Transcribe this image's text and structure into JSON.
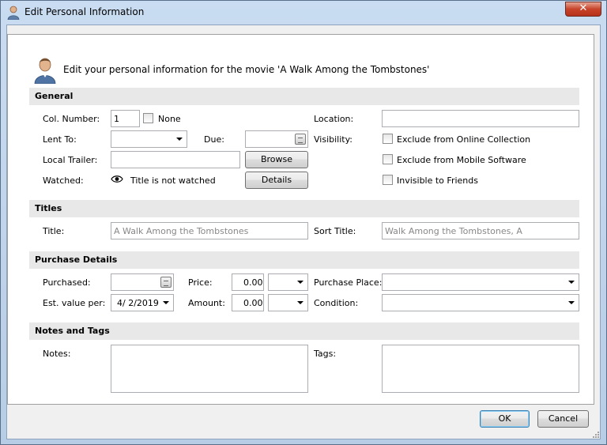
{
  "window": {
    "title": "Edit Personal Information",
    "close_symbol": "✕"
  },
  "header": {
    "text": "Edit your personal information for the movie 'A Walk Among the Tombstones'"
  },
  "sections": {
    "general": "General",
    "titles": "Titles",
    "purchase": "Purchase Details",
    "notes": "Notes and Tags"
  },
  "general": {
    "col_number_label": "Col. Number:",
    "col_number_value": "1",
    "none_label": "None",
    "lent_to_label": "Lent To:",
    "due_label": "Due:",
    "local_trailer_label": "Local Trailer:",
    "browse_label": "Browse",
    "watched_label": "Watched:",
    "watched_status": "Title is not watched",
    "details_label": "Details",
    "location_label": "Location:",
    "visibility_label": "Visibility:",
    "exclude_online": "Exclude from Online Collection",
    "exclude_mobile": "Exclude from Mobile Software",
    "invisible_friends": "Invisible to Friends"
  },
  "titles": {
    "title_label": "Title:",
    "title_value": "A Walk Among the Tombstones",
    "sort_title_label": "Sort Title:",
    "sort_title_value": "Walk Among the Tombstones, A"
  },
  "purchase": {
    "purchased_label": "Purchased:",
    "price_label": "Price:",
    "price_value": "0.00",
    "purchase_place_label": "Purchase Place:",
    "est_value_label": "Est. value per:",
    "est_value_date": "4/  2/2019",
    "amount_label": "Amount:",
    "amount_value": "0.00",
    "condition_label": "Condition:"
  },
  "notes": {
    "notes_label": "Notes:",
    "tags_label": "Tags:"
  },
  "footer": {
    "ok_label": "OK",
    "cancel_label": "Cancel"
  }
}
